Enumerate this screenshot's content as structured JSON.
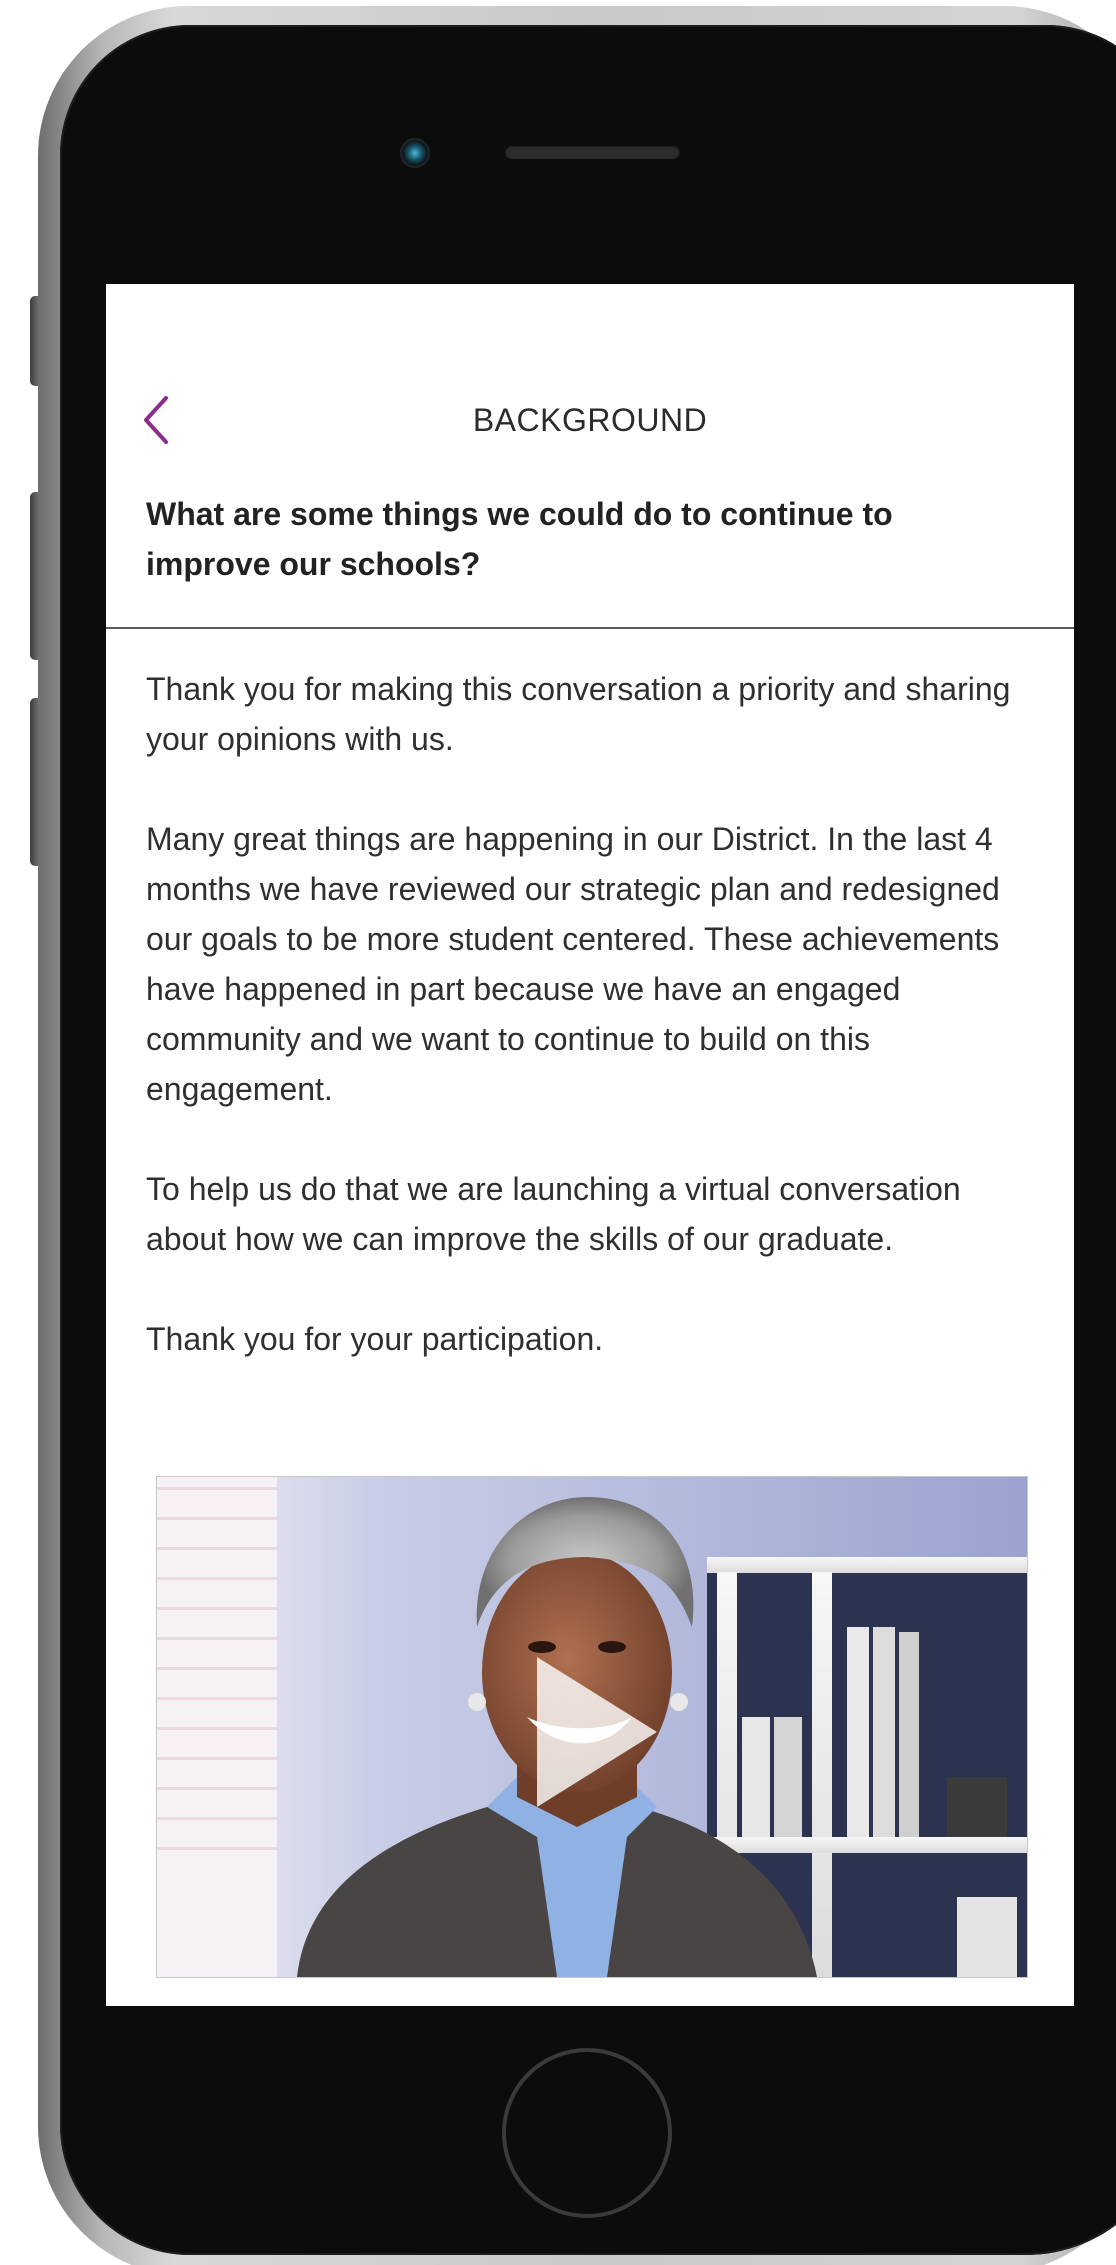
{
  "header": {
    "title": "BACKGROUND",
    "back_icon": "chevron-left-icon",
    "accent_color": "#8a2e8a"
  },
  "question": {
    "text": "What are some things we could do to continue to improve our schools?"
  },
  "body": {
    "paragraphs": [
      "Thank you for making this conversation a priority and sharing your opinions with us.",
      "Many great things are happening in our District. In the last 4 months we have reviewed our strategic plan and redesigned our goals to be more student centered. These achievements have happened in part because we have an engaged community and we want to continue to build on this engagement.",
      "To help us do that we are launching a virtual conversation about how we can improve the skills of our graduate.",
      "Thank you for your participation."
    ]
  },
  "video": {
    "play_icon": "play-icon"
  }
}
